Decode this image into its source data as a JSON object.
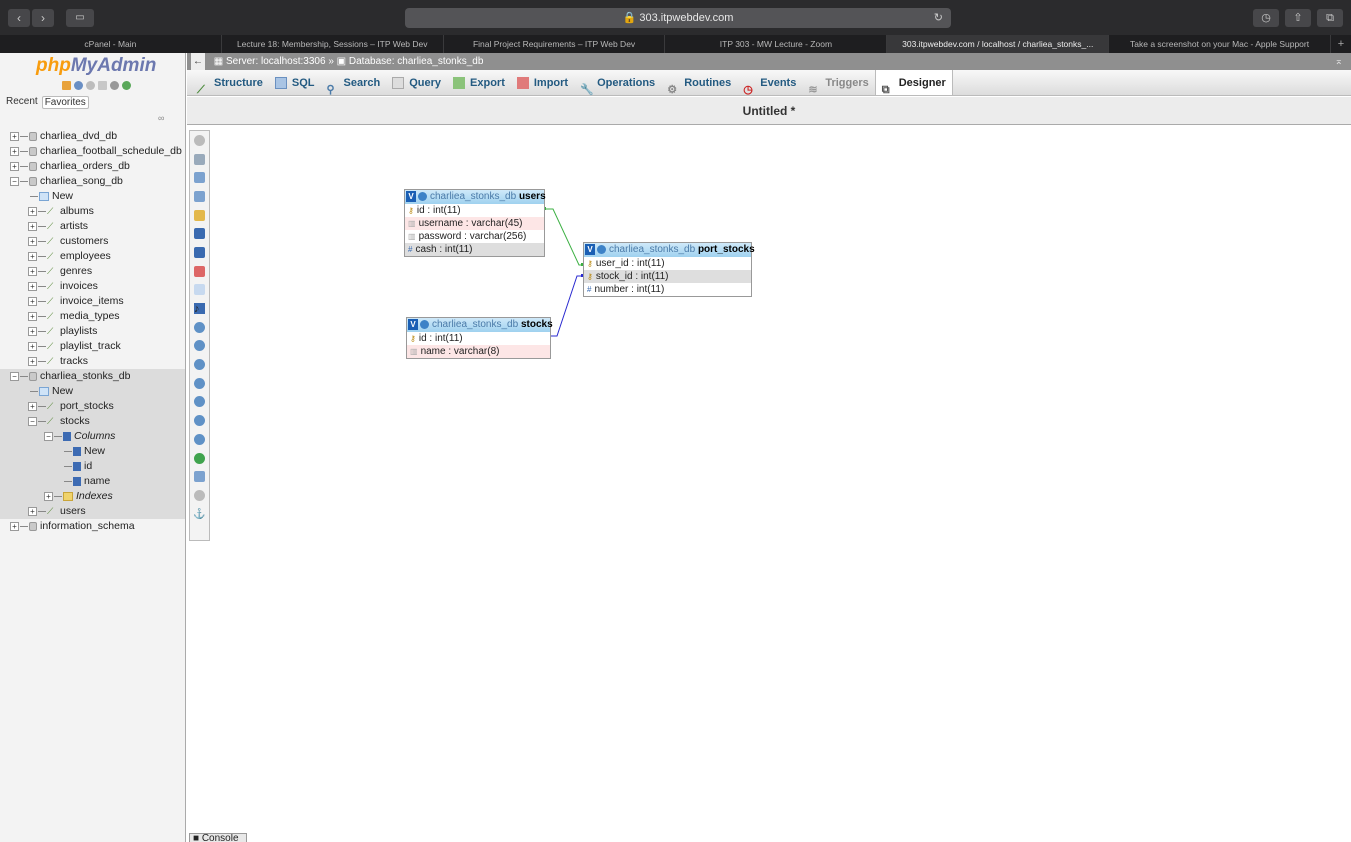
{
  "browser": {
    "url": "303.itpwebdev.com",
    "tabs": [
      "cPanel - Main",
      "Lecture 18: Membership, Sessions – ITP Web Dev",
      "Final Project Requirements – ITP Web Dev",
      "ITP 303 - MW Lecture - Zoom",
      "303.itpwebdev.com / localhost / charliea_stonks_...",
      "Take a screenshot on your Mac - Apple Support"
    ]
  },
  "sidebar": {
    "logo_php": "php",
    "logo_admin": "MyAdmin",
    "recent": "Recent",
    "favorites": "Favorites",
    "tree": {
      "db1": "charliea_dvd_db",
      "db2": "charliea_football_schedule_db",
      "db3": "charliea_orders_db",
      "db4": "charliea_song_db",
      "song_new": "New",
      "albums": "albums",
      "artists": "artists",
      "customers": "customers",
      "employees": "employees",
      "genres": "genres",
      "invoices": "invoices",
      "invoice_items": "invoice_items",
      "media_types": "media_types",
      "playlists": "playlists",
      "playlist_track": "playlist_track",
      "tracks": "tracks",
      "db5": "charliea_stonks_db",
      "stonks_new": "New",
      "port_stocks": "port_stocks",
      "stocks": "stocks",
      "columns": "Columns",
      "col_new": "New",
      "col_id": "id",
      "col_name": "name",
      "indexes": "Indexes",
      "users": "users",
      "db6": "information_schema"
    }
  },
  "breadcrumb": {
    "server": "Server: localhost:3306",
    "sep": "»",
    "database": "Database: charliea_stonks_db"
  },
  "menu": {
    "structure": "Structure",
    "sql": "SQL",
    "search": "Search",
    "query": "Query",
    "export": "Export",
    "import": "Import",
    "operations": "Operations",
    "routines": "Routines",
    "events": "Events",
    "triggers": "Triggers",
    "designer": "Designer"
  },
  "designer": {
    "title": "Untitled *",
    "tables": {
      "users": {
        "db": "charliea_stonks_db",
        "name": "users",
        "cols": [
          "id : int(11)",
          "username : varchar(45)",
          "password : varchar(256)",
          "cash : int(11)"
        ]
      },
      "port_stocks": {
        "db": "charliea_stonks_db",
        "name": "port_stocks",
        "cols": [
          "user_id : int(11)",
          "stock_id : int(11)",
          "number : int(11)"
        ]
      },
      "stocks": {
        "db": "charliea_stonks_db",
        "name": "stocks",
        "cols": [
          "id : int(11)",
          "name : varchar(8)"
        ]
      }
    },
    "relation_colors": {
      "users_port": "#3cb043",
      "stocks_port": "#2a2ad0"
    }
  },
  "console": "Console"
}
